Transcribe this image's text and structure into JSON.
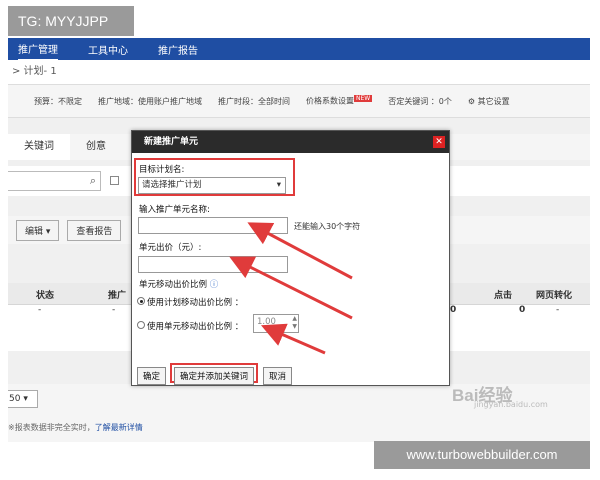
{
  "watermarks": {
    "top_left": "TG: MYYJJPP",
    "bottom_right": "www.turbowebbuilder.com",
    "baidu_logo": "Bai经验",
    "baidu_url": "jingyan.baidu.com"
  },
  "nav": {
    "items": [
      "推广管理",
      "工具中心",
      "推广报告"
    ]
  },
  "breadcrumb": "> 计划- 1",
  "info": {
    "budget": "预算：不限定",
    "region": "推广地域：使用账户推广地域",
    "time": "推广时段：全部时间",
    "price": "价格系数设置",
    "new_badge": "NEW",
    "negative": "否定关键词 ：0个",
    "other": "其它设置"
  },
  "tabs": [
    "关键词",
    "创意"
  ],
  "toolbar": {
    "edit": "编辑",
    "view": "查看报告"
  },
  "table": {
    "headers": [
      "状态",
      "推广",
      "点击",
      "网页转化"
    ],
    "row": [
      "-",
      "-",
      "0",
      "0",
      "-"
    ]
  },
  "bottom": {
    "page_size": "50",
    "footnote": "※报表数据非完全实时",
    "footnote_link": "了解最新详情"
  },
  "dialog": {
    "title": "新建推广单元",
    "plan_label": "目标计划名:",
    "plan_select": "请选择推广计划",
    "name_label": "输入推广单元名称:",
    "name_hint": "还能输入30个字符",
    "bid_label": "单元出价（元）:",
    "ratio_label": "单元移动出价比例",
    "opt_plan": "使用计划移动出价比例 ：",
    "opt_unit": "使用单元移动出价比例 ：",
    "ratio_value": "1.00",
    "btn_ok": "确定",
    "btn_ok_add": "确定并添加关键词",
    "btn_cancel": "取消"
  }
}
